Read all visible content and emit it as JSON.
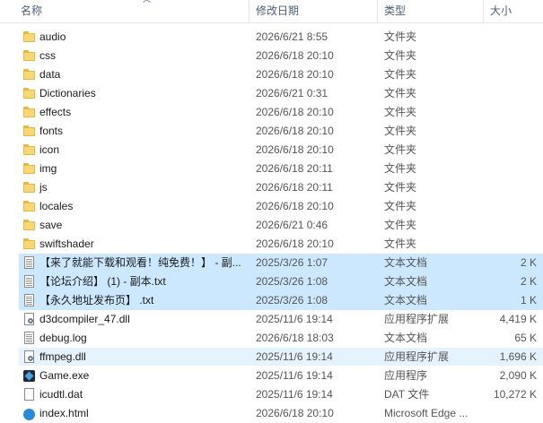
{
  "columns": {
    "name": "名称",
    "date": "修改日期",
    "type": "类型",
    "size": "大小"
  },
  "rows": [
    {
      "name": "audio",
      "date": "2026/6/21 8:55",
      "type": "文件夹",
      "size": "",
      "icon": "folder-icon",
      "state": ""
    },
    {
      "name": "css",
      "date": "2026/6/18 20:10",
      "type": "文件夹",
      "size": "",
      "icon": "folder-icon",
      "state": ""
    },
    {
      "name": "data",
      "date": "2026/6/18 20:10",
      "type": "文件夹",
      "size": "",
      "icon": "folder-icon",
      "state": ""
    },
    {
      "name": "Dictionaries",
      "date": "2026/6/21 0:31",
      "type": "文件夹",
      "size": "",
      "icon": "folder-icon",
      "state": ""
    },
    {
      "name": "effects",
      "date": "2026/6/18 20:10",
      "type": "文件夹",
      "size": "",
      "icon": "folder-icon",
      "state": ""
    },
    {
      "name": "fonts",
      "date": "2026/6/18 20:10",
      "type": "文件夹",
      "size": "",
      "icon": "folder-icon",
      "state": ""
    },
    {
      "name": "icon",
      "date": "2026/6/18 20:10",
      "type": "文件夹",
      "size": "",
      "icon": "folder-icon",
      "state": ""
    },
    {
      "name": "img",
      "date": "2026/6/18 20:11",
      "type": "文件夹",
      "size": "",
      "icon": "folder-icon",
      "state": ""
    },
    {
      "name": "js",
      "date": "2026/6/18 20:11",
      "type": "文件夹",
      "size": "",
      "icon": "folder-icon",
      "state": ""
    },
    {
      "name": "locales",
      "date": "2026/6/18 20:10",
      "type": "文件夹",
      "size": "",
      "icon": "folder-icon",
      "state": ""
    },
    {
      "name": "save",
      "date": "2026/6/21 0:46",
      "type": "文件夹",
      "size": "",
      "icon": "folder-icon",
      "state": ""
    },
    {
      "name": "swiftshader",
      "date": "2026/6/18 20:10",
      "type": "文件夹",
      "size": "",
      "icon": "folder-icon",
      "state": ""
    },
    {
      "name": "【来了就能下载和观看！纯免费！】 - 副...",
      "date": "2025/3/26 1:07",
      "type": "文本文档",
      "size": "2 K",
      "icon": "text-file-icon",
      "state": "selected"
    },
    {
      "name": "【论坛介绍】  (1) - 副本.txt",
      "date": "2025/3/26 1:08",
      "type": "文本文档",
      "size": "2 K",
      "icon": "text-file-icon",
      "state": "selected"
    },
    {
      "name": "【永久地址发布页】 .txt",
      "date": "2025/3/26 1:08",
      "type": "文本文档",
      "size": "1 K",
      "icon": "text-file-icon",
      "state": "selected"
    },
    {
      "name": "d3dcompiler_47.dll",
      "date": "2025/11/6 19:14",
      "type": "应用程序扩展",
      "size": "4,419 K",
      "icon": "dll-file-icon",
      "state": ""
    },
    {
      "name": "debug.log",
      "date": "2026/6/18 18:03",
      "type": "文本文档",
      "size": "65 K",
      "icon": "text-file-icon",
      "state": ""
    },
    {
      "name": "ffmpeg.dll",
      "date": "2025/11/6 19:14",
      "type": "应用程序扩展",
      "size": "1,696 K",
      "icon": "dll-file-icon",
      "state": "hover"
    },
    {
      "name": "Game.exe",
      "date": "2025/11/6 19:14",
      "type": "应用程序",
      "size": "2,090 K",
      "icon": "exe-file-icon",
      "state": ""
    },
    {
      "name": "icudtl.dat",
      "date": "2025/11/6 19:14",
      "type": "DAT 文件",
      "size": "10,272 K",
      "icon": "file-icon",
      "state": ""
    },
    {
      "name": "index.html",
      "date": "2026/6/18 20:10",
      "type": "Microsoft Edge ...",
      "size": "",
      "icon": "edge-html-icon",
      "state": ""
    }
  ]
}
